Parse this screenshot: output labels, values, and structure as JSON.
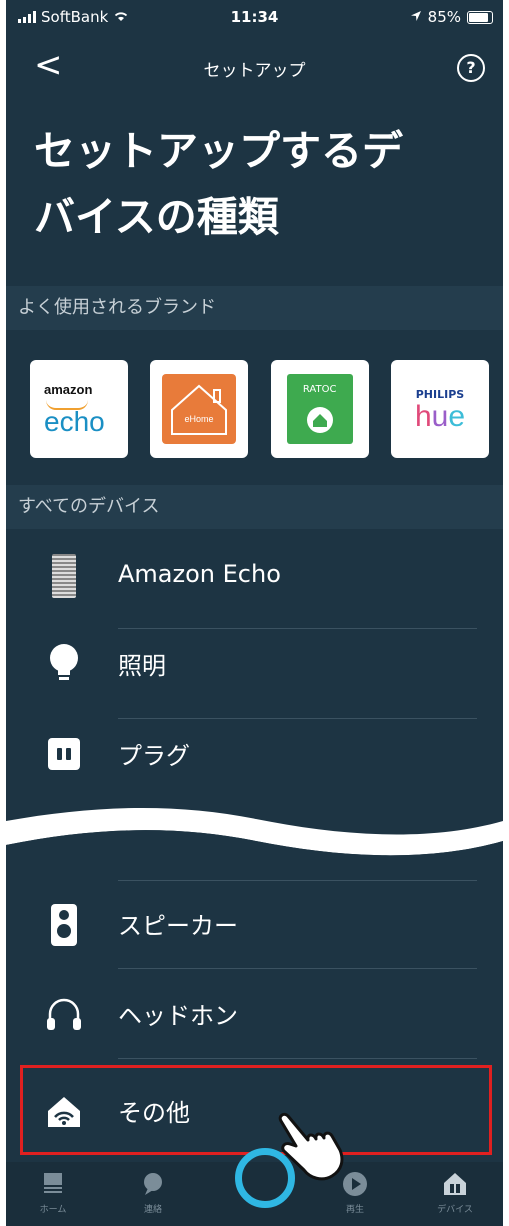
{
  "status": {
    "carrier": "SoftBank",
    "time": "11:34",
    "battery": "85%"
  },
  "nav": {
    "back": "<",
    "title": "セットアップ",
    "help": "?"
  },
  "title": "セットアップするデバイスの種類",
  "title_lines": [
    "セットアップするデ",
    "バイスの種類"
  ],
  "sections": {
    "brands": "よく使用されるブランド",
    "all": "すべてのデバイス"
  },
  "brands": [
    {
      "name": "amazon echo",
      "top": "amazon",
      "bottom": "echo"
    },
    {
      "name": "eHome",
      "label": "eHome"
    },
    {
      "name": "RATOC",
      "label": "RATOC"
    },
    {
      "name": "PHILIPS hue",
      "top": "PHILIPS",
      "bottom": "hue"
    }
  ],
  "devices": [
    {
      "label": "Amazon Echo",
      "icon": "echo-device-icon"
    },
    {
      "label": "照明",
      "icon": "light-bulb-icon"
    },
    {
      "label": "プラグ",
      "icon": "plug-icon"
    },
    {
      "label": "スピーカー",
      "icon": "speaker-icon"
    },
    {
      "label": "ヘッドホン",
      "icon": "headphones-icon"
    },
    {
      "label": "その他",
      "icon": "other-devices-icon"
    }
  ],
  "tabs": [
    {
      "label": "ホーム",
      "icon": "home-icon"
    },
    {
      "label": "連絡",
      "icon": "chat-icon"
    },
    {
      "label": "",
      "icon": "alexa-icon"
    },
    {
      "label": "再生",
      "icon": "play-icon"
    },
    {
      "label": "デバイス",
      "icon": "devices-icon"
    }
  ],
  "colors": {
    "background": "#1d3443",
    "section": "#243d4d",
    "highlight": "#e02020",
    "alexa": "#2fb7e3"
  }
}
